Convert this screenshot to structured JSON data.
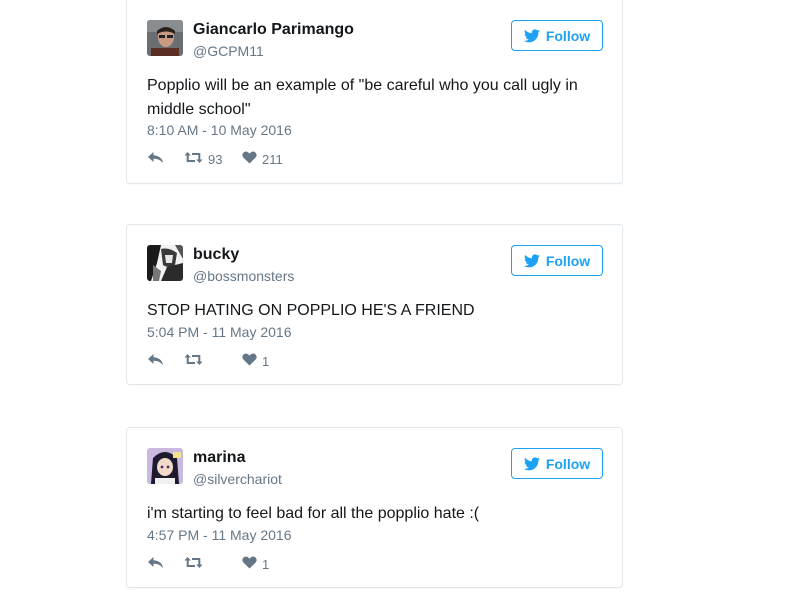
{
  "colors": {
    "accent": "#1da1f2",
    "text_primary": "#14171a",
    "text_secondary": "#657786",
    "card_border": "#e1e8ed"
  },
  "tweets": [
    {
      "author_name": "Giancarlo Parimango",
      "author_handle": "@GCPM11",
      "follow_label": "Follow",
      "text": "Popplio will be an example of \"be careful who you call ugly in middle school\"",
      "timestamp": "8:10 AM - 10 May 2016",
      "retweet_count": "93",
      "like_count": "211",
      "icons": [
        "reply-icon",
        "retweet-icon",
        "heart-icon"
      ]
    },
    {
      "author_name": "bucky",
      "author_handle": "@bossmonsters",
      "follow_label": "Follow",
      "text": "STOP HATING ON POPPLIO HE'S A FRIEND",
      "timestamp": "5:04 PM - 11 May 2016",
      "retweet_count": "",
      "like_count": "1",
      "icons": [
        "reply-icon",
        "retweet-icon",
        "heart-icon"
      ]
    },
    {
      "author_name": "marina",
      "author_handle": "@silverchariot",
      "follow_label": "Follow",
      "text": "i'm starting to feel bad for all the popplio hate :(",
      "timestamp": "4:57 PM - 11 May 2016",
      "retweet_count": "",
      "like_count": "1",
      "icons": [
        "reply-icon",
        "retweet-icon",
        "heart-icon"
      ]
    }
  ]
}
